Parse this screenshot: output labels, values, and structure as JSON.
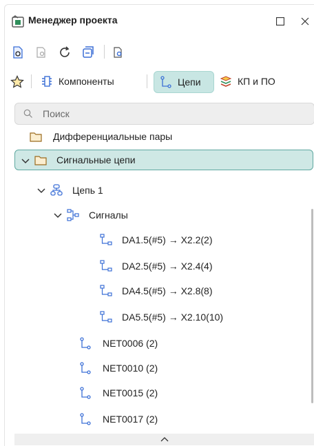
{
  "title": "Менеджер проекта",
  "tabs": [
    {
      "label": "Компоненты"
    },
    {
      "label": "Цепи"
    },
    {
      "label": "КП и ПО"
    }
  ],
  "search": {
    "placeholder": "Поиск"
  },
  "tree": [
    {
      "label": "Дифференциальные пары"
    },
    {
      "label": "Сигнальные цепи"
    },
    {
      "label": "Цепь 1"
    },
    {
      "label": "Сигналы"
    },
    {
      "label": "DA1.5(#5) → X2.2(2)"
    },
    {
      "label": "DA2.5(#5) → X2.4(4)"
    },
    {
      "label": "DA4.5(#5) → X2.8(8)"
    },
    {
      "label": "DA5.5(#5) → X2.10(10)"
    },
    {
      "label": "NET0006 (2)"
    },
    {
      "label": "NET0010 (2)"
    },
    {
      "label": "NET0015 (2)"
    },
    {
      "label": "NET0017 (2)"
    }
  ],
  "colors": {
    "accent": "#cfe8e5",
    "accent_border": "#5ea8a0",
    "icon_blue": "#3b6fd6"
  },
  "icons": [
    "project-manager-icon",
    "restore-icon",
    "close-icon",
    "document-view-icon",
    "search-doc-icon",
    "refresh-icon",
    "collapse-icon",
    "find-icon",
    "star-icon",
    "component-icon",
    "net-icon",
    "layers-icon",
    "folder-icon",
    "chevron-down-icon",
    "chain-icon",
    "signals-icon",
    "connection-icon",
    "net-line-icon",
    "scroll-up-icon"
  ]
}
